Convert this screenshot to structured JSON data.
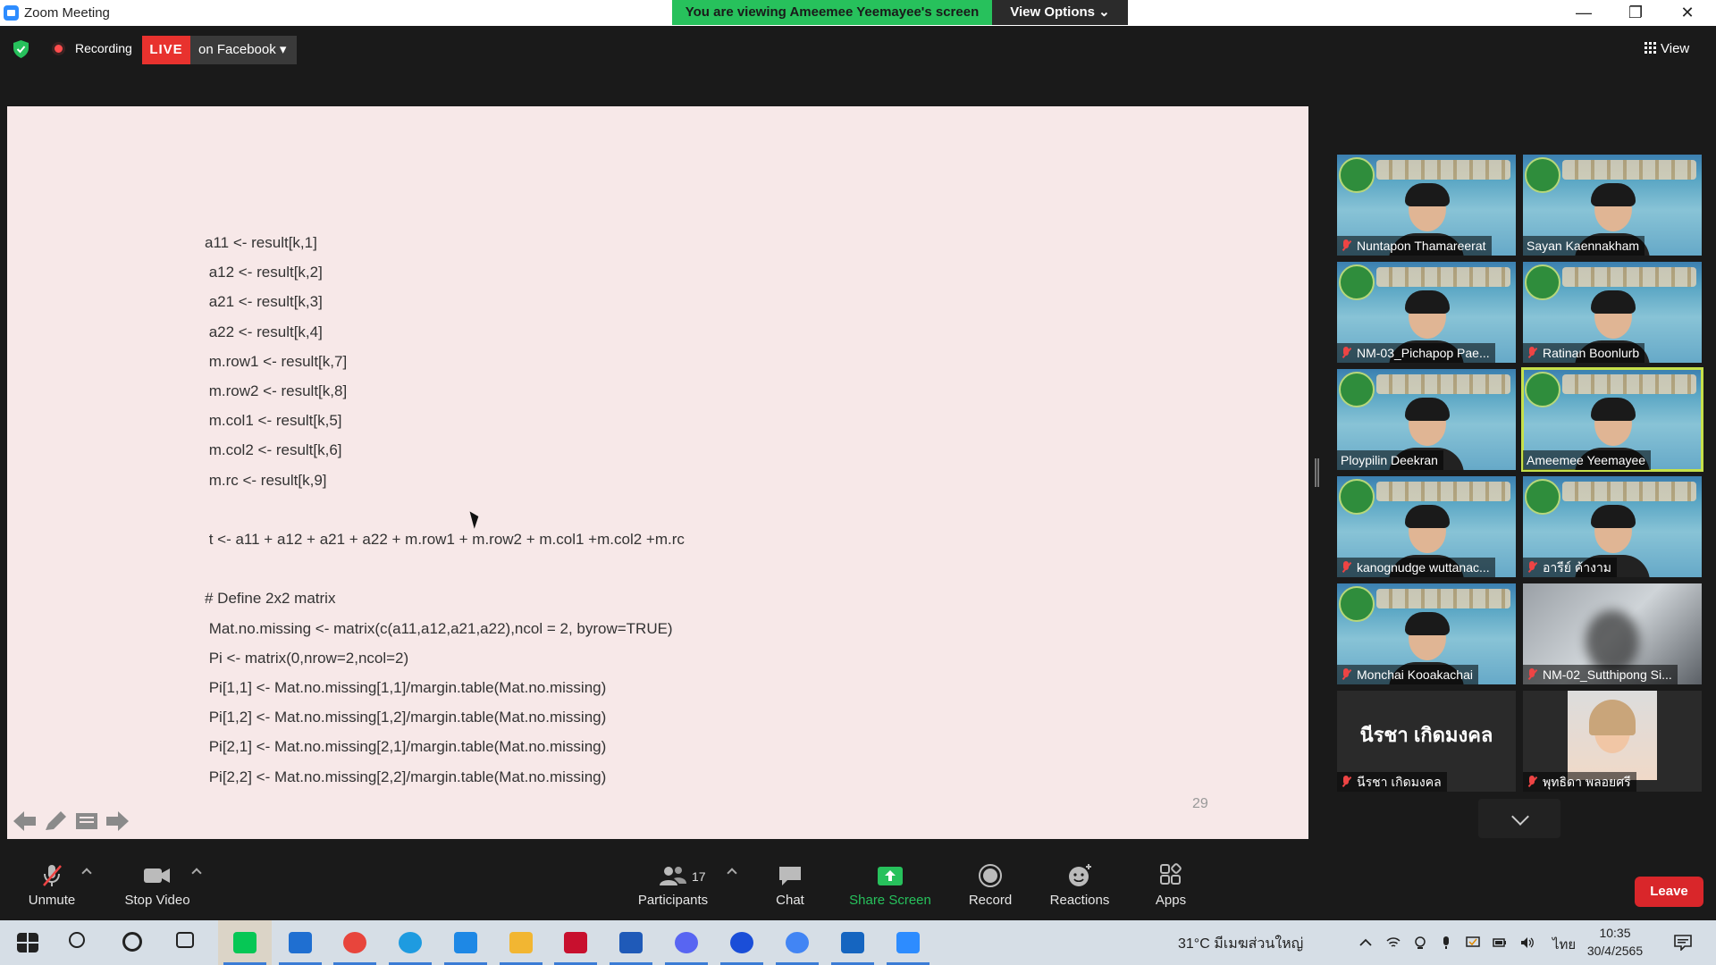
{
  "window": {
    "title": "Zoom Meeting",
    "banner": "You are viewing Ameemee Yeemayee's screen",
    "view_options": "View Options ⌄",
    "minimize": "—",
    "restore": "❐",
    "close": "✕"
  },
  "meeting": {
    "recording_label": "Recording",
    "live_badge": "LIVE",
    "live_platform": "on Facebook ▾",
    "view_label": "View"
  },
  "shared_content": {
    "code_lines": [
      "a11 <- result[k,1]",
      " a12 <- result[k,2]",
      " a21 <- result[k,3]",
      " a22 <- result[k,4]",
      " m.row1 <- result[k,7]",
      " m.row2 <- result[k,8]",
      " m.col1 <- result[k,5]",
      " m.col2 <- result[k,6]",
      " m.rc <- result[k,9]",
      "",
      " t <- a11 + a12 + a21 + a22 + m.row1 + m.row2 + m.col1 +m.col2 +m.rc",
      "",
      "# Define 2x2 matrix",
      " Mat.no.missing <- matrix(c(a11,a12,a21,a22),ncol = 2, byrow=TRUE)",
      " Pi <- matrix(0,nrow=2,ncol=2)",
      " Pi[1,1] <- Mat.no.missing[1,1]/margin.table(Mat.no.missing)",
      " Pi[1,2] <- Mat.no.missing[1,2]/margin.table(Mat.no.missing)",
      " Pi[2,1] <- Mat.no.missing[2,1]/margin.table(Mat.no.missing)",
      " Pi[2,2] <- Mat.no.missing[2,2]/margin.table(Mat.no.missing)"
    ],
    "slide_number": "29"
  },
  "participants": [
    {
      "name": "Nuntapon Thamareerat",
      "muted": true,
      "style": "banner"
    },
    {
      "name": "Sayan Kaennakham",
      "muted": false,
      "style": "banner"
    },
    {
      "name": "NM-03_Pichapop Pae...",
      "muted": true,
      "style": "banner"
    },
    {
      "name": "Ratinan Boonlurb",
      "muted": true,
      "style": "banner"
    },
    {
      "name": "Ploypilin Deekran",
      "muted": false,
      "style": "banner"
    },
    {
      "name": "Ameemee Yeemayee",
      "muted": false,
      "style": "banner",
      "active": true
    },
    {
      "name": "kanognudge wuttanac...",
      "muted": true,
      "style": "banner"
    },
    {
      "name": "อารีย์ ค้างาม",
      "muted": true,
      "style": "banner"
    },
    {
      "name": "Monchai Kooakachai",
      "muted": true,
      "style": "banner"
    },
    {
      "name": "NM-02_Sutthipong Si...",
      "muted": true,
      "style": "blurred"
    },
    {
      "name": "นีรชา เกิดมงคล",
      "muted": true,
      "style": "name-only",
      "display_name": "นีรชา เกิดมงคล"
    },
    {
      "name": "พุทธิดา พลอยศรี",
      "muted": true,
      "style": "photo"
    }
  ],
  "controls": {
    "unmute": "Unmute",
    "stop_video": "Stop Video",
    "participants": "Participants",
    "participants_count": "17",
    "chat": "Chat",
    "share_screen": "Share Screen",
    "record": "Record",
    "reactions": "Reactions",
    "apps": "Apps",
    "leave": "Leave"
  },
  "taskbar": {
    "apps": [
      "start",
      "search",
      "cortana",
      "task-view",
      "line",
      "mail",
      "chrome",
      "edge",
      "lark",
      "file-explorer",
      "mcafee",
      "word",
      "discord",
      "webex",
      "chrome-profile",
      "photos",
      "zoom"
    ],
    "weather": "31°C  มีเมฆส่วนใหญ่",
    "language": "ไทย",
    "time": "10:35",
    "date": "30/4/2565"
  },
  "colors": {
    "accent_green": "#27c15c",
    "live_red": "#e8322e",
    "leave_red": "#d9262a",
    "active_speaker": "#c6e04a"
  }
}
